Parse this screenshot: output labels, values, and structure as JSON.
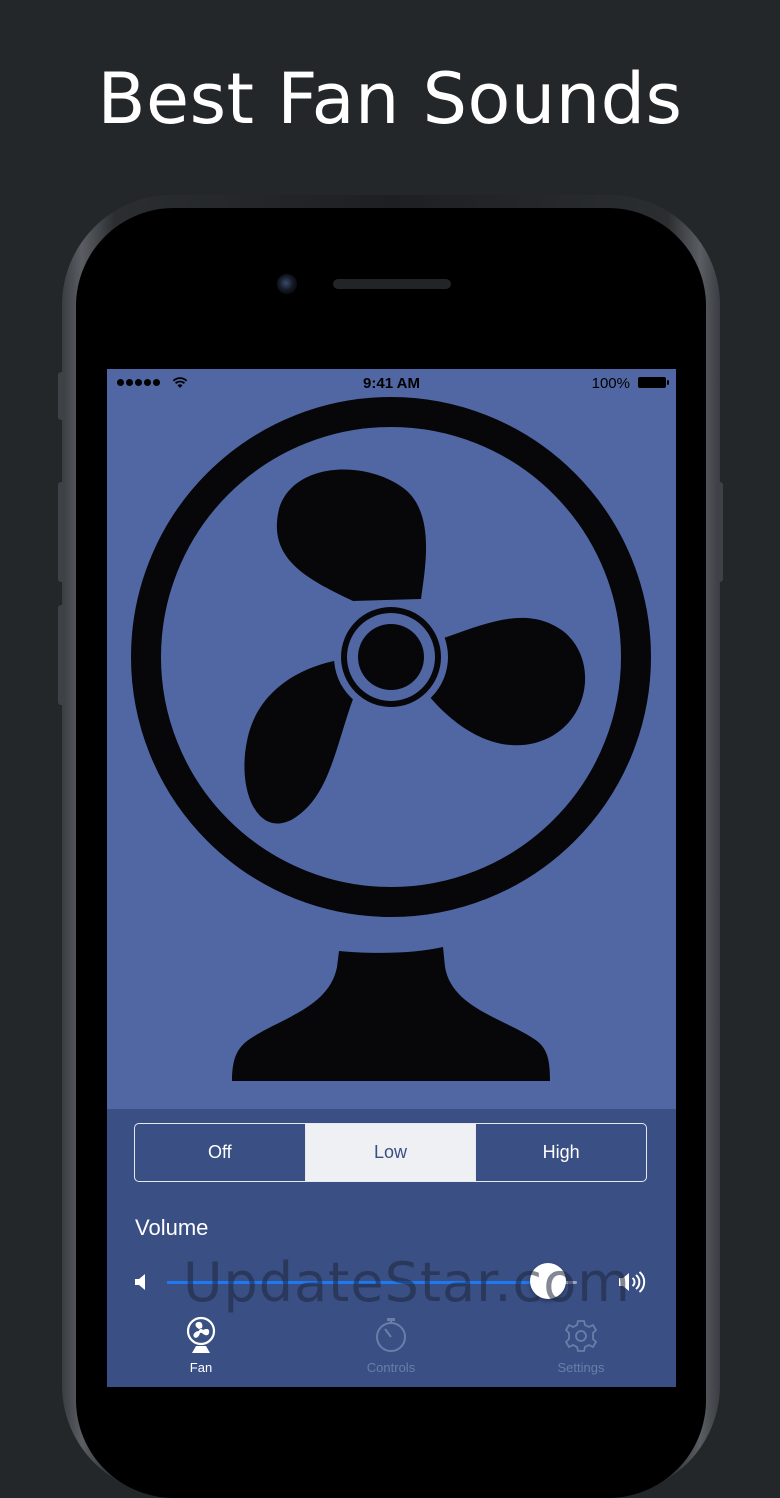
{
  "headline": "Best Fan Sounds",
  "status_bar": {
    "time": "9:41 AM",
    "battery": "100%"
  },
  "fan_modes": {
    "options": [
      "Off",
      "Low",
      "High"
    ],
    "selected": "Low"
  },
  "volume": {
    "label": "Volume",
    "level": 0.93
  },
  "tabs": [
    {
      "label": "Fan",
      "icon": "fan-icon",
      "active": true
    },
    {
      "label": "Controls",
      "icon": "stopwatch-icon",
      "active": false
    },
    {
      "label": "Settings",
      "icon": "gear-icon",
      "active": false
    }
  ],
  "watermark": "UpdateStar.com",
  "colors": {
    "screen_bg": "#5167a4",
    "panel_bg": "#3a4f84",
    "accent": "#1e78f0"
  }
}
